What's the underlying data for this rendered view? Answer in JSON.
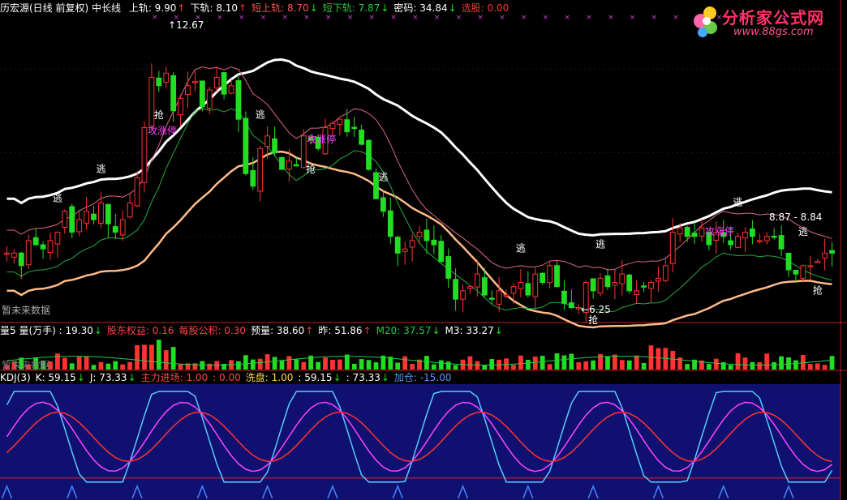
{
  "colors": {
    "up": "#ff3333",
    "down": "#22dd22",
    "white": "#ffffff",
    "magenta": "#ff44ff",
    "orange": "#ffbb88",
    "pink": "#dd6688",
    "green_line": "#22aa44",
    "cyan": "#55ccff",
    "yellow": "#ffdd55",
    "kdj_bg": "#101070"
  },
  "main": {
    "title": "历宏源(日线 前复权) 中长线",
    "params": [
      {
        "label": "上轨: 9.90",
        "arrow": "↑",
        "color": "#ffffff",
        "arrow_color": "#ff3333"
      },
      {
        "label": "下轨: 8.10",
        "arrow": "↑",
        "color": "#ffffff",
        "arrow_color": "#ff3333"
      },
      {
        "label": "短上轨: 8.70",
        "arrow": "↓",
        "color": "#ff5555",
        "arrow_color": "#22dd22"
      },
      {
        "label": "短下轨: 7.87",
        "arrow": "↓",
        "color": "#22cc44",
        "arrow_color": "#22dd22"
      },
      {
        "label": "密码: 34.84",
        "arrow": "↓",
        "color": "#ffffff",
        "arrow_color": "#22dd22"
      },
      {
        "label": "选股: 0.00",
        "arrow": "",
        "color": "#ff3333",
        "arrow_color": "#ff3333"
      }
    ],
    "high_label": "12.67",
    "low_label": "6.25",
    "range_label": "8.87 - 8.84",
    "no_data": "暂未来数据",
    "signals": {
      "escape": "逃",
      "grab": "抢",
      "limit": "攻涨停"
    }
  },
  "volume": {
    "params": [
      {
        "label": "量5 量(万手) : 19.30",
        "arrow": "↓",
        "color": "#ffffff",
        "arrow_color": "#22dd22"
      },
      {
        "label": "股东权益: 0.16",
        "arrow": "",
        "color": "#ff4444",
        "arrow_color": "#ff4444"
      },
      {
        "label": "每股公积: 0.30",
        "arrow": "",
        "color": "#ff4444",
        "arrow_color": "#ff4444"
      },
      {
        "label": "预量: 38.60",
        "arrow": "↑",
        "color": "#ffffff",
        "arrow_color": "#ff3333"
      },
      {
        "label": "昨: 51.86",
        "arrow": "↑",
        "color": "#ffffff",
        "arrow_color": "#ff3333"
      },
      {
        "label": "M20: 37.57",
        "arrow": "↓",
        "color": "#22cc44",
        "arrow_color": "#22dd22"
      },
      {
        "label": "M3: 33.27",
        "arrow": "↓",
        "color": "#ffffff",
        "arrow_color": "#22dd22"
      }
    ],
    "no_data": "暂未来数据"
  },
  "kdj": {
    "params": [
      {
        "label": "KDJ(3)",
        "arrow": "",
        "color": "#ffffff",
        "arrow_color": "#ffffff"
      },
      {
        "label": "K: 59.15",
        "arrow": "↓",
        "color": "#ffffff",
        "arrow_color": "#22dd22"
      },
      {
        "label": "J: 73.33",
        "arrow": "↓",
        "color": "#ffffff",
        "arrow_color": "#22dd22"
      },
      {
        "label": "主力进场: 1.00",
        "arrow": "",
        "color": "#ff4444",
        "arrow_color": "#ff4444"
      },
      {
        "label": ": 0.00",
        "arrow": "",
        "color": "#ff4444",
        "arrow_color": "#ff4444"
      },
      {
        "label": "洗盘: 1.00",
        "arrow": "",
        "color": "#ffdd55",
        "arrow_color": "#ffdd55"
      },
      {
        "label": ": 59.15",
        "arrow": "↓",
        "color": "#ffffff",
        "arrow_color": "#22dd22"
      },
      {
        "label": ": 73.33",
        "arrow": "↓",
        "color": "#ffffff",
        "arrow_color": "#22dd22"
      },
      {
        "label": "加仓: -15.00",
        "arrow": "",
        "color": "#5599ff",
        "arrow_color": "#5599ff"
      }
    ]
  },
  "logo": {
    "name": "分析家公式网",
    "url": "www.88gs.com"
  },
  "chart_data": {
    "type": "candlestick",
    "price_ylim": [
      6.0,
      13.3
    ],
    "kdj_ylim": [
      -10,
      110
    ],
    "n_bars": 115,
    "close": [
      7.6,
      7.6,
      7.3,
      7.9,
      7.8,
      7.7,
      7.9,
      8.1,
      8.6,
      8.1,
      8.4,
      8.6,
      8.4,
      8.8,
      8.3,
      8.1,
      8.4,
      8.8,
      9.4,
      10.6,
      11.8,
      11.6,
      11.9,
      11.0,
      11.3,
      11.6,
      11.7,
      11.1,
      11.5,
      11.8,
      11.4,
      11.6,
      10.8,
      9.5,
      9.2,
      10.1,
      10.4,
      10.0,
      9.6,
      9.8,
      9.7,
      10.4,
      10.3,
      10.1,
      10.6,
      10.7,
      10.8,
      10.5,
      10.6,
      10.2,
      9.6,
      8.9,
      8.6,
      8.0,
      7.6,
      7.7,
      7.9,
      8.1,
      7.9,
      7.8,
      7.4,
      7.0,
      6.5,
      6.7,
      6.8,
      7.1,
      6.6,
      6.5,
      6.7,
      6.6,
      6.8,
      6.9,
      6.6,
      7.1,
      6.9,
      7.3,
      6.8,
      6.4,
      6.3,
      6.3,
      6.9,
      6.7,
      7.0,
      6.8,
      6.9,
      7.1,
      6.7,
      6.7,
      6.8,
      6.9,
      7.0,
      7.3,
      8.1,
      8.2,
      8.0,
      8.0,
      8.2,
      7.8,
      8.1,
      8.0,
      7.8,
      8.0,
      8.1,
      8.0,
      7.9,
      8.0,
      8.0,
      7.7,
      7.2,
      7.1,
      7.3,
      7.3,
      7.4,
      7.6,
      7.6
    ],
    "volume_ylim": [
      0,
      60
    ],
    "kdj_series": [
      "K",
      "D",
      "J"
    ],
    "labels_escape_bars": [
      7,
      13,
      35,
      52,
      71,
      82,
      101,
      110
    ],
    "labels_grab_bars": [
      21,
      42,
      81,
      112
    ]
  }
}
